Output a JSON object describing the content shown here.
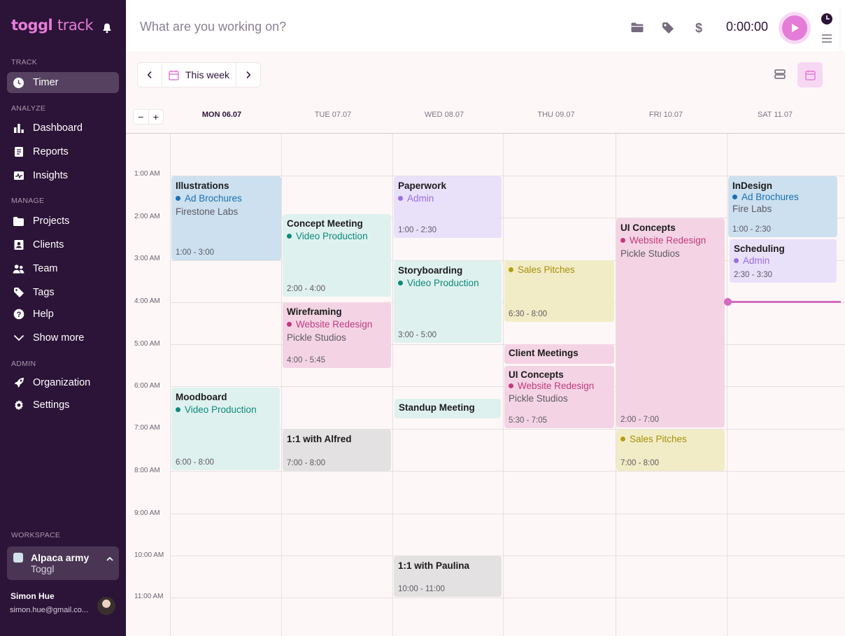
{
  "app": {
    "logo_main": "toggl",
    "logo_sub": "track"
  },
  "sidebar": {
    "sections": {
      "track": "TRACK",
      "analyze": "ANALYZE",
      "manage": "MANAGE",
      "admin": "ADMIN",
      "workspace": "WORKSPACE"
    },
    "items": {
      "timer": "Timer",
      "dashboard": "Dashboard",
      "reports": "Reports",
      "insights": "Insights",
      "projects": "Projects",
      "clients": "Clients",
      "team": "Team",
      "tags": "Tags",
      "help": "Help",
      "show_more": "Show more",
      "organization": "Organization",
      "settings": "Settings"
    },
    "workspace": {
      "name": "Alpaca army",
      "org": "Toggl"
    },
    "user": {
      "name": "Simon Hue",
      "email": "simon.hue@gmail.co..."
    }
  },
  "topbar": {
    "placeholder": "What are you working on?",
    "timer": "0:00:00"
  },
  "calendar": {
    "range_label": "This week",
    "zoom_out": "−",
    "zoom_in": "+",
    "days": [
      "MON 06.07",
      "TUE 07.07",
      "WED 08.07",
      "THU 09.07",
      "FRI 10.07",
      "SAT 11.07"
    ],
    "hours": [
      "1:00 AM",
      "2:00 AM",
      "3:00 AM",
      "4:00 AM",
      "5:00 AM",
      "6:00 AM",
      "7:00 AM",
      "8:00 AM",
      "9:00 AM",
      "10:00 AM",
      "11:00 AM"
    ],
    "events": [
      {
        "title": "Illustrations",
        "project": "Ad Brochures",
        "client": "Firestone Labs",
        "time": "1:00 - 3:00",
        "color": "blue"
      },
      {
        "title": "Moodboard",
        "project": "Video Production",
        "client": "",
        "time": "6:00 - 8:00",
        "color": "teal"
      },
      {
        "title": "Concept Meeting",
        "project": "Video Production",
        "client": "",
        "time": "2:00 - 4:00",
        "color": "teal"
      },
      {
        "title": "Wireframing",
        "project": "Website Redesign",
        "client": "Pickle Studios",
        "time": "4:00 - 5:45",
        "color": "pink"
      },
      {
        "title": "1:1 with Alfred",
        "project": "",
        "client": "",
        "time": "7:00 - 8:00",
        "color": "grey"
      },
      {
        "title": "Paperwork",
        "project": "Admin",
        "client": "",
        "time": "1:00 - 2:30",
        "color": "purple"
      },
      {
        "title": "Storyboarding",
        "project": "Video Production",
        "client": "",
        "time": "3:00 - 5:00",
        "color": "teal"
      },
      {
        "title": "Standup Meeting",
        "project": "",
        "client": "",
        "time": "",
        "color": "teal"
      },
      {
        "title": "1:1 with Paulina",
        "project": "",
        "client": "",
        "time": "10:00 - 11:00",
        "color": "grey"
      },
      {
        "title": "",
        "project": "Sales Pitches",
        "client": "",
        "time": "6:30 - 8:00",
        "color": "yellow"
      },
      {
        "title": "Client Meetings",
        "project": "",
        "client": "",
        "time": "",
        "color": "pink"
      },
      {
        "title": "UI Concepts",
        "project": "Website Redesign",
        "client": "Pickle Studios",
        "time": "5:30 - 7:05",
        "color": "pink"
      },
      {
        "title": "UI Concepts",
        "project": "Website Redesign",
        "client": "Pickle Studios",
        "time": "2:00 - 7:00",
        "color": "pink"
      },
      {
        "title": "",
        "project": "Sales Pitches",
        "client": "",
        "time": "7:00 - 8:00",
        "color": "yellow"
      },
      {
        "title": "InDesign",
        "project": "Ad Brochures",
        "client": "Fire Labs",
        "time": "1:00 - 2:30",
        "color": "blue"
      },
      {
        "title": "Scheduling",
        "project": "Admin",
        "client": "",
        "time": "2:30 - 3:30",
        "color": "purple"
      }
    ]
  },
  "colors": {
    "sidebar_bg": "#2c1338",
    "accent": "#e57cd8",
    "now_line": "#d26bbf"
  }
}
